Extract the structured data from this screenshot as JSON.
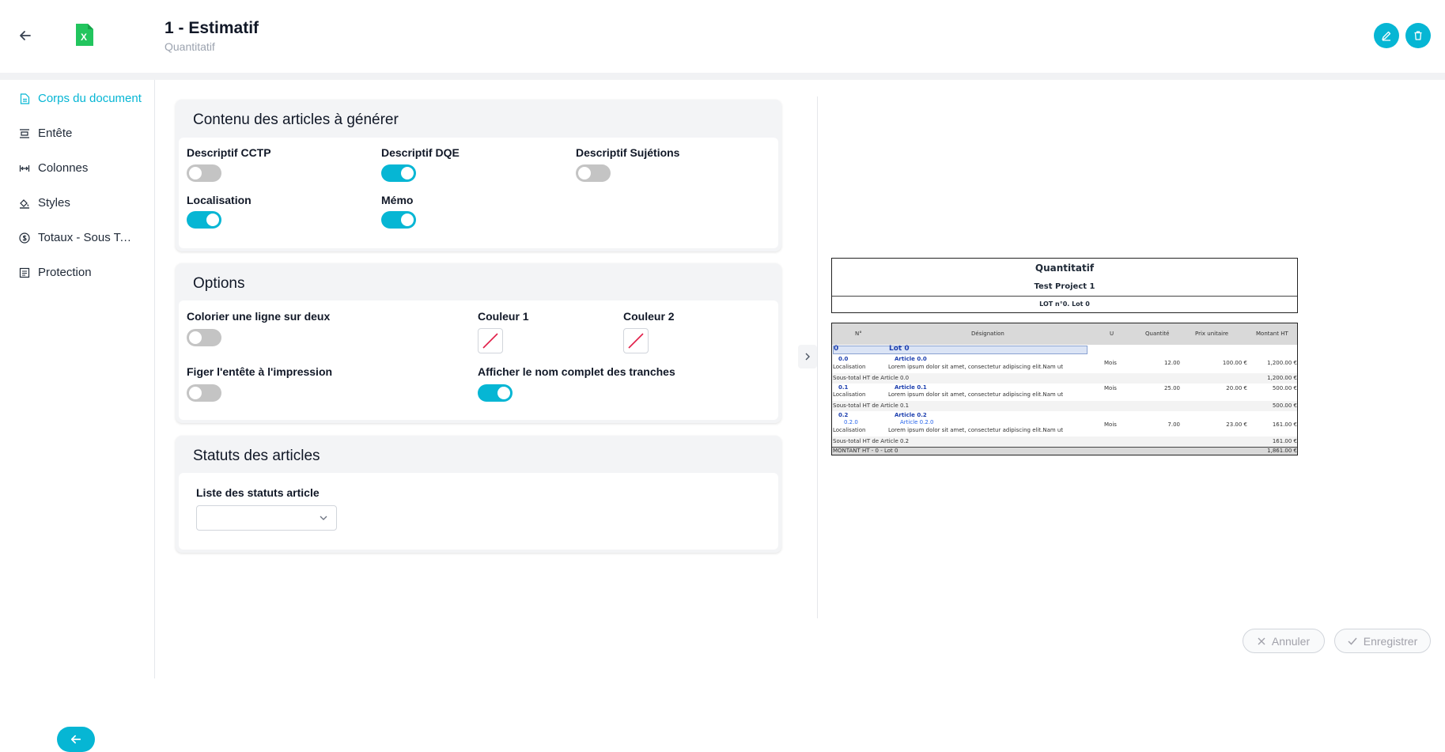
{
  "header": {
    "title": "1 - Estimatif",
    "subtitle": "Quantitatif",
    "file_icon_letter": "X"
  },
  "sidebar": {
    "items": [
      {
        "label": "Corps du document",
        "icon": "document-icon",
        "active": true
      },
      {
        "label": "Entête",
        "icon": "header-icon",
        "active": false
      },
      {
        "label": "Colonnes",
        "icon": "columns-icon",
        "active": false
      },
      {
        "label": "Styles",
        "icon": "paint-bucket-icon",
        "active": false
      },
      {
        "label": "Totaux - Sous Totaux",
        "icon": "dollar-circle-icon",
        "active": false
      },
      {
        "label": "Protection",
        "icon": "protection-icon",
        "active": false
      }
    ]
  },
  "contenu": {
    "title": "Contenu des articles à générer",
    "fields": [
      {
        "label": "Descriptif CCTP",
        "on": false
      },
      {
        "label": "Descriptif DQE",
        "on": true
      },
      {
        "label": "Descriptif Sujétions",
        "on": false
      },
      {
        "label": "Localisation",
        "on": true
      },
      {
        "label": "Mémo",
        "on": true
      }
    ]
  },
  "options": {
    "title": "Options",
    "alternate_label": "Colorier une ligne sur deux",
    "alternate_on": false,
    "color1_label": "Couleur 1",
    "color2_label": "Couleur 2",
    "freeze_label": "Figer l'entête à l'impression",
    "freeze_on": false,
    "fullname_label": "Afficher le nom complet des tranches",
    "fullname_on": true
  },
  "statuts": {
    "title": "Statuts des articles",
    "list_label": "Liste des statuts article",
    "selected": ""
  },
  "preview": {
    "title": "Quantitatif",
    "project": "Test Project 1",
    "lot_line": "LOT n°0. Lot 0",
    "columns": [
      "N°",
      "Désignation",
      "U",
      "Quantité",
      "Prix unitaire",
      "Montant HT"
    ],
    "lot_no": "0",
    "lot_name": "Lot 0",
    "articles": [
      {
        "no": "0.0",
        "name": "Article 0.0",
        "loc_label": "Localisation",
        "text": "Lorem ipsum dolor sit amet, consectetur adipiscing elit.Nam ut",
        "unit": "Mois",
        "qty": "12.00",
        "price": "100.00 €",
        "amount": "1,200.00 €",
        "subtotal_label": "Sous-total HT de Article 0.0",
        "subtotal": "1,200.00 €"
      },
      {
        "no": "0.1",
        "name": "Article 0.1",
        "loc_label": "Localisation",
        "text": "Lorem ipsum dolor sit amet, consectetur adipiscing elit.Nam ut",
        "unit": "Mois",
        "qty": "25.00",
        "price": "20.00 €",
        "amount": "500.00 €",
        "subtotal_label": "Sous-total HT de Article 0.1",
        "subtotal": "500.00 €"
      },
      {
        "no": "0.2",
        "name": "Article 0.2",
        "sub_no": "0.2.0",
        "sub_name": "Article 0.2.0",
        "loc_label": "Localisation",
        "text": "Lorem ipsum dolor sit amet, consectetur adipiscing elit.Nam ut",
        "unit": "Mois",
        "qty": "7.00",
        "price": "23.00 €",
        "amount": "161.00 €",
        "subtotal_label": "Sous-total HT de Article 0.2",
        "subtotal": "161.00 €"
      }
    ],
    "total_label": "MONTANT HT - 0 - Lot 0",
    "total": "1,861.00 €"
  },
  "footer": {
    "cancel_label": "Annuler",
    "save_label": "Enregistrer"
  },
  "colors": {
    "accent": "#06b6d4",
    "excel_green": "#22c55e"
  }
}
